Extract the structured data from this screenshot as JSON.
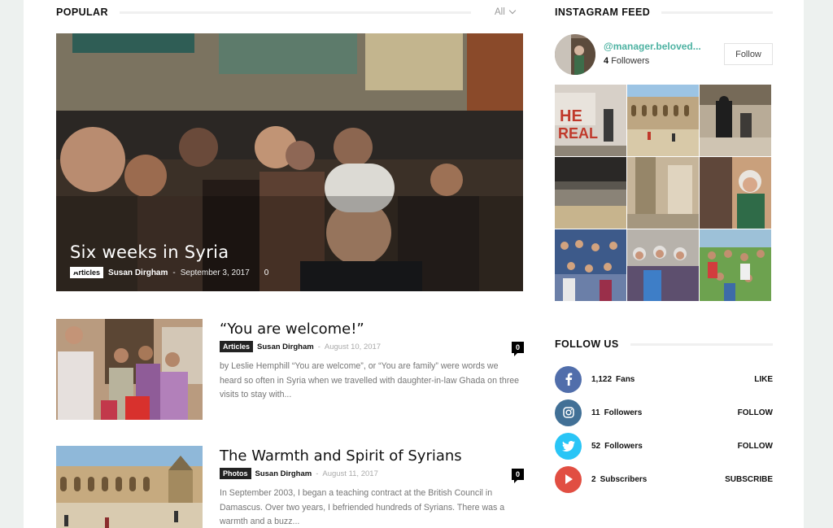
{
  "popular": {
    "heading": "POPULAR",
    "filter_label": "All"
  },
  "featured": {
    "title": "Six weeks in Syria",
    "category": "Articles",
    "author": "Susan Dirgham",
    "date": "September 3, 2017",
    "comments": "0"
  },
  "posts": [
    {
      "title": "“You are welcome!”",
      "category": "Articles",
      "author": "Susan Dirgham",
      "date": "August 10, 2017",
      "comments": "0",
      "excerpt": "by Leslie Hemphill “You are welcome”, or “You are family” were words we heard so often in Syria when we travelled with daughter-in-law Ghada on three visits to stay with..."
    },
    {
      "title": "The Warmth and Spirit of Syrians",
      "category": "Photos",
      "author": "Susan Dirgham",
      "date": "August 11, 2017",
      "comments": "0",
      "excerpt": "In September 2003, I began a teaching contract at the British Council in Damascus. Over two years, I befriended hundreds of Syrians. There was a warmth and a buzz..."
    }
  ],
  "instagram": {
    "heading": "INSTAGRAM FEED",
    "username": "@manager.beloved...",
    "followers_count": "4",
    "followers_label": "Followers",
    "follow_label": "Follow"
  },
  "follow_us": {
    "heading": "FOLLOW US",
    "networks": [
      {
        "icon": "facebook-icon",
        "count": "1,122",
        "unit": "Fans",
        "action": "LIKE",
        "color": "#516eab"
      },
      {
        "icon": "instagram-icon",
        "count": "11",
        "unit": "Followers",
        "action": "FOLLOW",
        "color": "#417096"
      },
      {
        "icon": "twitter-icon",
        "count": "52",
        "unit": "Followers",
        "action": "FOLLOW",
        "color": "#29c5f6"
      },
      {
        "icon": "youtube-icon",
        "count": "2",
        "unit": "Subscribers",
        "action": "SUBSCRIBE",
        "color": "#e14e42"
      }
    ]
  },
  "colors": {
    "accent": "#4db2a2",
    "background": "#edf1ef"
  }
}
